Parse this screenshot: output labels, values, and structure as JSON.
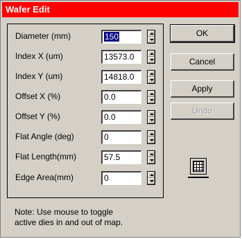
{
  "window": {
    "title": "Wafer  Edit"
  },
  "fields": [
    {
      "label": "Diameter (mm)",
      "value": "150",
      "selected": true
    },
    {
      "label": "Index X (um)",
      "value": "13573.0"
    },
    {
      "label": "Index Y (um)",
      "value": "14818.0"
    },
    {
      "label": "Offset  X (%)",
      "value": "0.0"
    },
    {
      "label": "Offset  Y (%)",
      "value": "0.0"
    },
    {
      "label": "Flat Angle (deg)",
      "value": "0"
    },
    {
      "label": "Flat Length(mm)",
      "value": "57.5"
    },
    {
      "label": "Edge Area(mm)",
      "value": "0"
    }
  ],
  "buttons": {
    "ok": "OK",
    "cancel": "Cancel",
    "apply": "Apply",
    "undo": "Undo"
  },
  "icons": {
    "map_toggle": "grid-icon"
  },
  "note": {
    "line1": "Note: Use mouse to toggle",
    "line2": "active dies in and out of map."
  },
  "colors": {
    "title_bar": "#ff0000",
    "dialog_bg": "#d4d0c8",
    "selection": "#000080"
  }
}
